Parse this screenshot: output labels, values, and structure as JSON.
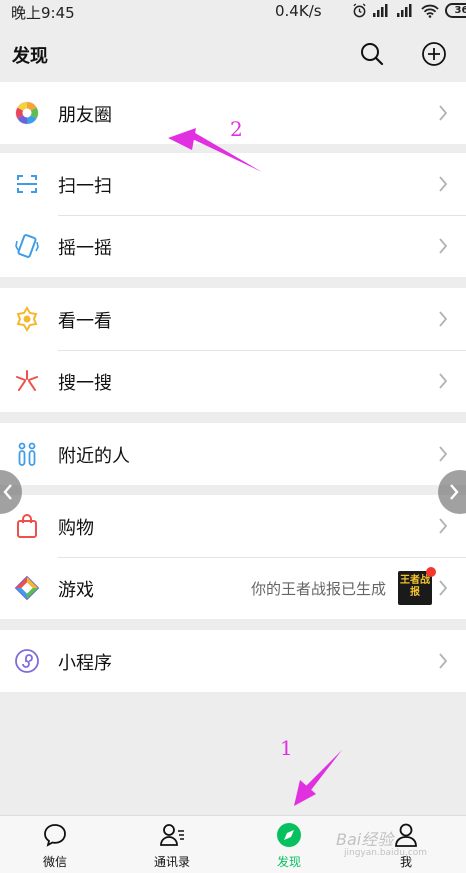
{
  "status_bar": {
    "time": "晚上9:45",
    "network_speed": "0.4K/s",
    "battery": "36",
    "icons": [
      "alarm-icon",
      "signal-icon",
      "signal-icon",
      "wifi-icon",
      "battery-icon"
    ]
  },
  "header": {
    "title": "发现",
    "search_icon": "search-icon",
    "add_icon": "plus-circle-icon"
  },
  "groups": [
    {
      "items": [
        {
          "label": "朋友圈",
          "icon": "moments-icon"
        }
      ]
    },
    {
      "items": [
        {
          "label": "扫一扫",
          "icon": "scan-icon"
        },
        {
          "label": "摇一摇",
          "icon": "shake-icon"
        }
      ]
    },
    {
      "items": [
        {
          "label": "看一看",
          "icon": "top-stories-icon"
        },
        {
          "label": "搜一搜",
          "icon": "search-feature-icon"
        }
      ]
    },
    {
      "items": [
        {
          "label": "附近的人",
          "icon": "people-nearby-icon"
        }
      ]
    },
    {
      "items": [
        {
          "label": "购物",
          "icon": "shopping-bag-icon"
        },
        {
          "label": "游戏",
          "icon": "games-icon",
          "extra": "你的王者战报已生成",
          "thumb_text": "王者战报"
        }
      ]
    },
    {
      "items": [
        {
          "label": "小程序",
          "icon": "mini-programs-icon"
        }
      ]
    }
  ],
  "tabs": [
    {
      "label": "微信",
      "icon": "chat-bubble-icon",
      "active": false
    },
    {
      "label": "通讯录",
      "icon": "contacts-icon",
      "active": false
    },
    {
      "label": "发现",
      "icon": "discover-compass-icon",
      "active": true
    },
    {
      "label": "我",
      "icon": "me-person-icon",
      "active": false
    }
  ],
  "annotations": {
    "step1": "1",
    "step2": "2"
  },
  "watermark": {
    "main": "Bai经验",
    "sub": "jingyan.baidu.com"
  },
  "colors": {
    "accent": "#07c160",
    "annotation": "#e030e0",
    "background": "#ededed"
  }
}
